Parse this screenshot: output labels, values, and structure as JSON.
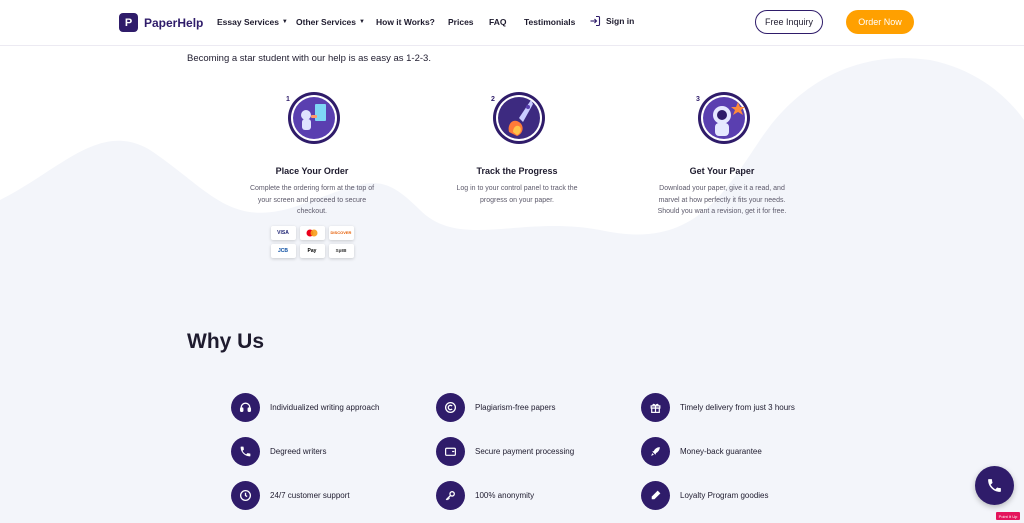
{
  "header": {
    "logo_letter": "P",
    "logo_text": "PaperHelp",
    "nav": {
      "essay_services": "Essay Services",
      "other_services": "Other Services",
      "how_it_works": "How it Works?",
      "prices": "Prices",
      "faq": "FAQ",
      "testimonials": "Testimonials",
      "sign_in": "Sign in"
    },
    "free_inquiry": "Free Inquiry",
    "order_now": "Order Now"
  },
  "intro_text": "Becoming a star student with our help is as easy as 1-2-3.",
  "steps": [
    {
      "number": "1",
      "title": "Place Your Order",
      "description": "Complete the ordering form at the top of your screen and proceed to secure checkout."
    },
    {
      "number": "2",
      "title": "Track the Progress",
      "description": "Log in to your control panel to track the progress on your paper."
    },
    {
      "number": "3",
      "title": "Get Your Paper",
      "description": "Download your paper, give it a read, and marvel at how perfectly it fits your needs. Should you want a revision, get it for free."
    }
  ],
  "payment_cards": [
    "VISA",
    "",
    "DISCOVER",
    "JCB",
    "Pay",
    "Sp88"
  ],
  "why_us_title": "Why Us",
  "features": [
    {
      "label": "Individualized writing approach",
      "icon": "headset-icon"
    },
    {
      "label": "Plagiarism-free papers",
      "icon": "copyright-icon"
    },
    {
      "label": "Timely delivery from just 3 hours",
      "icon": "gift-icon"
    },
    {
      "label": "Degreed writers",
      "icon": "phone-icon"
    },
    {
      "label": "Secure payment processing",
      "icon": "wallet-icon"
    },
    {
      "label": "Money-back guarantee",
      "icon": "rocket-icon"
    },
    {
      "label": "24/7 customer support",
      "icon": "clock-icon"
    },
    {
      "label": "100% anonymity",
      "icon": "key-icon"
    },
    {
      "label": "Loyalty Program goodies",
      "icon": "pen-icon"
    }
  ],
  "corner_badge": "Point It Up",
  "colors": {
    "brand": "#2f1c6a",
    "accent": "#ffa000",
    "wave": "#f3f5fa"
  }
}
